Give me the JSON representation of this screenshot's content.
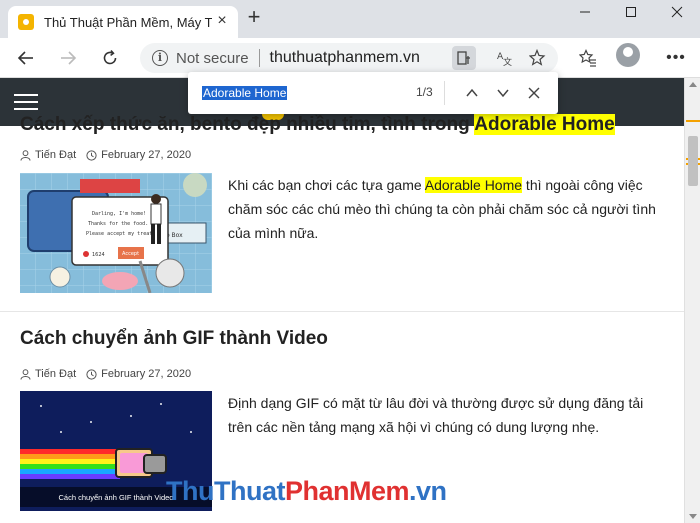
{
  "browser": {
    "tab_title": "Thủ Thuật Phần Mềm, Máy Tính,",
    "tab_close": "×",
    "new_tab": "+",
    "security_label": "Not secure",
    "url": "thuthuatphanmem.vn",
    "window_controls": {
      "minimize": "—",
      "maximize": "☐",
      "close": "✕"
    }
  },
  "find_bar": {
    "query": "Adorable Home",
    "match_count": "1/3"
  },
  "articles": [
    {
      "title_prefix": "Cách xếp thức ăn, bento đẹp nhiều tim, tình trong ",
      "title_highlight": "Adorable Home",
      "author": "Tiến Đạt",
      "date": "February 27, 2020",
      "excerpt_before": "Khi các bạn chơi các tựa game ",
      "excerpt_highlight": "Adorable Home",
      "excerpt_after": " thì ngoài công việc chăm sóc các chú mèo thì chúng ta còn phải chăm sóc cả người tình của mình nữa.",
      "thumb_texts": [
        "Darling, I'm home!",
        "Thanks for the food.",
        "Please accept my treat.",
        "1624",
        "Accept",
        "Bento Box"
      ]
    },
    {
      "title": "Cách chuyển ảnh GIF thành Video",
      "author": "Tiến Đạt",
      "date": "February 27, 2020",
      "excerpt": "Định dạng GIF có mặt từ lâu đời và thường được sử dụng đăng tải trên các nền tảng mạng xã hội vì chúng có dung lượng nhẹ.",
      "thumb_caption": "Cách chuyển ảnh GIF thành Video"
    }
  ],
  "watermark": {
    "part1": "ThuThuat",
    "part2": "PhanMem",
    "part3": ".vn"
  },
  "colors": {
    "highlight": "#ffff00",
    "header_bg": "#2c3338",
    "accent": "#f4c400"
  }
}
